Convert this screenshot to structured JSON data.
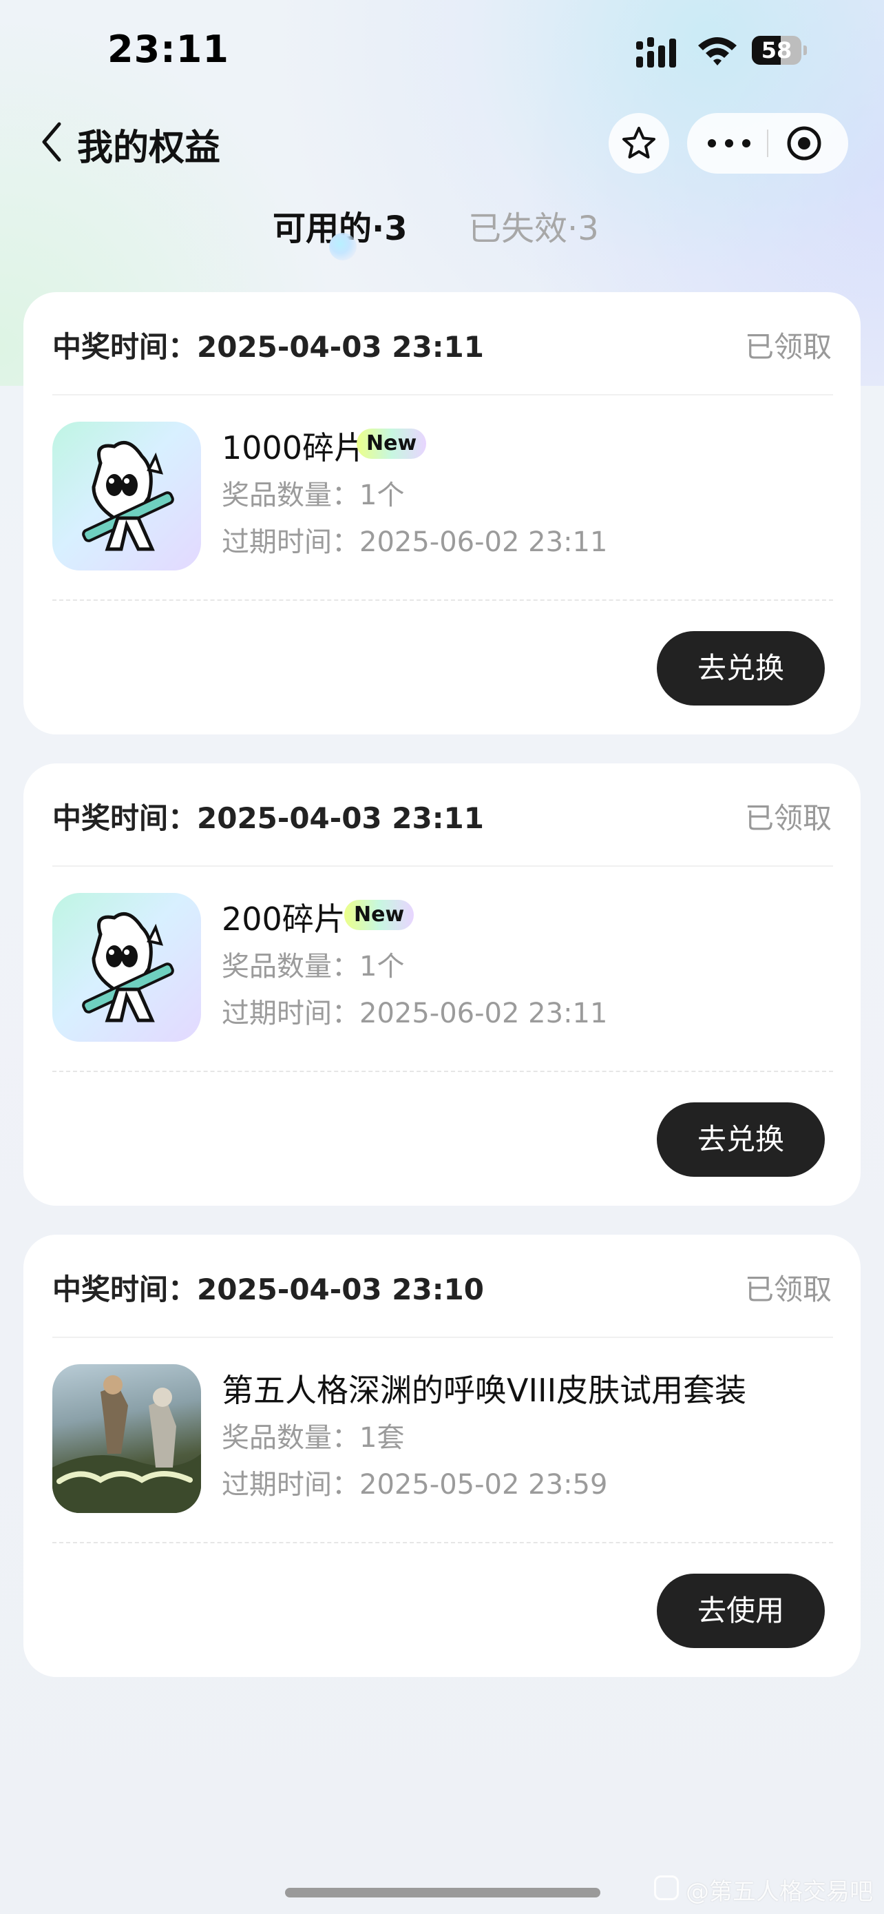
{
  "status_bar": {
    "time": "23:11",
    "battery": "58",
    "battery_level": 0.58
  },
  "nav": {
    "title": "我的权益"
  },
  "tabs": [
    {
      "label": "可用的·3",
      "active": true
    },
    {
      "label": "已失效·3",
      "active": false
    }
  ],
  "cards": [
    {
      "win_time": "中奖时间：2025-04-03 23:11",
      "status": "已领取",
      "item_name": "1000碎片",
      "badge": "New",
      "quantity": "奖品数量：1个",
      "expire": "过期时间：2025-06-02 23:11",
      "action": "去兑换",
      "thumb_icon": "guitar-mascot-icon"
    },
    {
      "win_time": "中奖时间：2025-04-03 23:11",
      "status": "已领取",
      "item_name": "200碎片",
      "badge": "New",
      "quantity": "奖品数量：1个",
      "expire": "过期时间：2025-06-02 23:11",
      "action": "去兑换",
      "thumb_icon": "guitar-mascot-icon"
    },
    {
      "win_time": "中奖时间：2025-04-03 23:10",
      "status": "已领取",
      "item_name": "第五人格深渊的呼唤VIII皮肤试用套装",
      "badge": null,
      "quantity": "奖品数量：1套",
      "expire": "过期时间：2025-05-02 23:59",
      "action": "去使用",
      "thumb_icon": "game-artwork-image"
    }
  ],
  "watermark": "@第五人格交易吧",
  "colors": {
    "button_bg": "#222222",
    "muted_text": "#9b9b9b",
    "accent_badge": "#ecff8a"
  }
}
